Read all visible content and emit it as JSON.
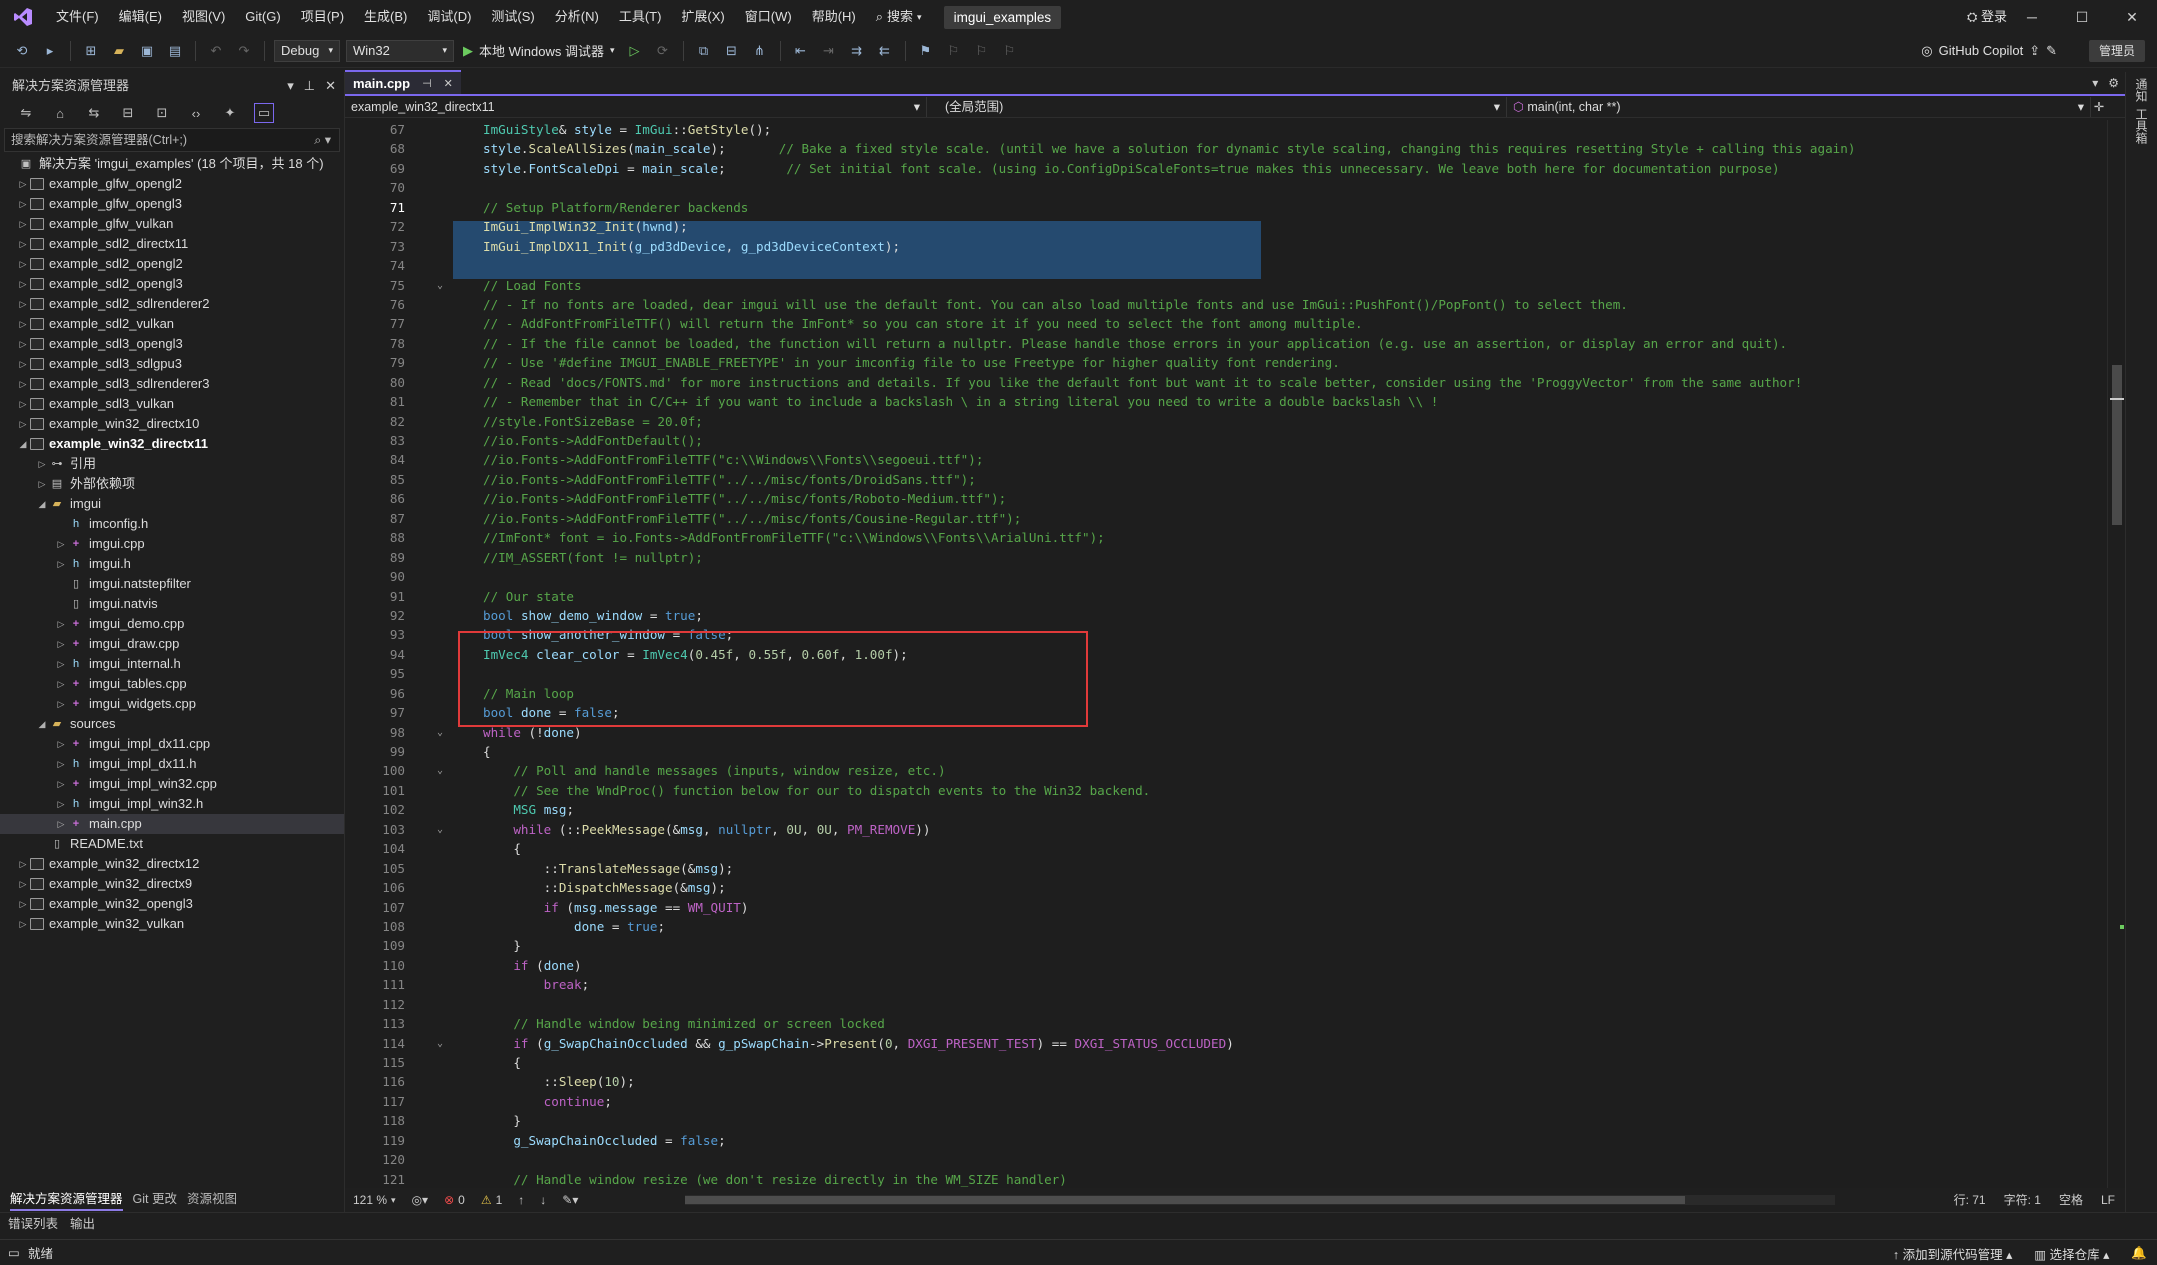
{
  "menubar": {
    "items": [
      "文件(F)",
      "编辑(E)",
      "视图(V)",
      "Git(G)",
      "项目(P)",
      "生成(B)",
      "调试(D)",
      "测试(S)",
      "分析(N)",
      "工具(T)",
      "扩展(X)",
      "窗口(W)",
      "帮助(H)"
    ],
    "search": "搜索",
    "solution_name": "imgui_examples",
    "login": "登录"
  },
  "toolbar": {
    "config": "Debug",
    "platform": "Win32",
    "run_label": "本地 Windows 调试器",
    "copilot": "GitHub Copilot",
    "admin": "管理员"
  },
  "solution_explorer": {
    "title": "解决方案资源管理器",
    "search_placeholder": "搜索解决方案资源管理器(Ctrl+;)",
    "items": [
      {
        "label": "解决方案 'imgui_examples' (18 个项目，共 18 个)",
        "indent": 0,
        "chev": "",
        "icon": "solution"
      },
      {
        "label": "example_glfw_opengl2",
        "indent": 1,
        "chev": "▷",
        "icon": "proj"
      },
      {
        "label": "example_glfw_opengl3",
        "indent": 1,
        "chev": "▷",
        "icon": "proj"
      },
      {
        "label": "example_glfw_vulkan",
        "indent": 1,
        "chev": "▷",
        "icon": "proj"
      },
      {
        "label": "example_sdl2_directx11",
        "indent": 1,
        "chev": "▷",
        "icon": "proj"
      },
      {
        "label": "example_sdl2_opengl2",
        "indent": 1,
        "chev": "▷",
        "icon": "proj"
      },
      {
        "label": "example_sdl2_opengl3",
        "indent": 1,
        "chev": "▷",
        "icon": "proj"
      },
      {
        "label": "example_sdl2_sdlrenderer2",
        "indent": 1,
        "chev": "▷",
        "icon": "proj"
      },
      {
        "label": "example_sdl2_vulkan",
        "indent": 1,
        "chev": "▷",
        "icon": "proj"
      },
      {
        "label": "example_sdl3_opengl3",
        "indent": 1,
        "chev": "▷",
        "icon": "proj"
      },
      {
        "label": "example_sdl3_sdlgpu3",
        "indent": 1,
        "chev": "▷",
        "icon": "proj"
      },
      {
        "label": "example_sdl3_sdlrenderer3",
        "indent": 1,
        "chev": "▷",
        "icon": "proj"
      },
      {
        "label": "example_sdl3_vulkan",
        "indent": 1,
        "chev": "▷",
        "icon": "proj"
      },
      {
        "label": "example_win32_directx10",
        "indent": 1,
        "chev": "▷",
        "icon": "proj"
      },
      {
        "label": "example_win32_directx11",
        "indent": 1,
        "chev": "◢",
        "icon": "proj",
        "bold": true
      },
      {
        "label": "引用",
        "indent": 2,
        "chev": "▷",
        "icon": "ref"
      },
      {
        "label": "外部依赖项",
        "indent": 2,
        "chev": "▷",
        "icon": "ext"
      },
      {
        "label": "imgui",
        "indent": 2,
        "chev": "◢",
        "icon": "folder"
      },
      {
        "label": "imconfig.h",
        "indent": 3,
        "chev": "",
        "icon": "h"
      },
      {
        "label": "imgui.cpp",
        "indent": 3,
        "chev": "▷",
        "icon": "cpp"
      },
      {
        "label": "imgui.h",
        "indent": 3,
        "chev": "▷",
        "icon": "h"
      },
      {
        "label": "imgui.natstepfilter",
        "indent": 3,
        "chev": "",
        "icon": "file"
      },
      {
        "label": "imgui.natvis",
        "indent": 3,
        "chev": "",
        "icon": "file"
      },
      {
        "label": "imgui_demo.cpp",
        "indent": 3,
        "chev": "▷",
        "icon": "cpp"
      },
      {
        "label": "imgui_draw.cpp",
        "indent": 3,
        "chev": "▷",
        "icon": "cpp"
      },
      {
        "label": "imgui_internal.h",
        "indent": 3,
        "chev": "▷",
        "icon": "h"
      },
      {
        "label": "imgui_tables.cpp",
        "indent": 3,
        "chev": "▷",
        "icon": "cpp"
      },
      {
        "label": "imgui_widgets.cpp",
        "indent": 3,
        "chev": "▷",
        "icon": "cpp"
      },
      {
        "label": "sources",
        "indent": 2,
        "chev": "◢",
        "icon": "folder"
      },
      {
        "label": "imgui_impl_dx11.cpp",
        "indent": 3,
        "chev": "▷",
        "icon": "cpp"
      },
      {
        "label": "imgui_impl_dx11.h",
        "indent": 3,
        "chev": "▷",
        "icon": "h"
      },
      {
        "label": "imgui_impl_win32.cpp",
        "indent": 3,
        "chev": "▷",
        "icon": "cpp"
      },
      {
        "label": "imgui_impl_win32.h",
        "indent": 3,
        "chev": "▷",
        "icon": "h"
      },
      {
        "label": "main.cpp",
        "indent": 3,
        "chev": "▷",
        "icon": "cpp",
        "selected": true
      },
      {
        "label": "README.txt",
        "indent": 2,
        "chev": "",
        "icon": "file"
      },
      {
        "label": "example_win32_directx12",
        "indent": 1,
        "chev": "▷",
        "icon": "proj"
      },
      {
        "label": "example_win32_directx9",
        "indent": 1,
        "chev": "▷",
        "icon": "proj"
      },
      {
        "label": "example_win32_opengl3",
        "indent": 1,
        "chev": "▷",
        "icon": "proj"
      },
      {
        "label": "example_win32_vulkan",
        "indent": 1,
        "chev": "▷",
        "icon": "proj"
      }
    ],
    "bottom_tabs": [
      "解决方案资源管理器",
      "Git 更改",
      "资源视图"
    ]
  },
  "editor": {
    "tab": "main.cpp",
    "nav_project": "example_win32_directx11",
    "nav_scope": "(全局范围)",
    "nav_function": "main(int, char **)",
    "current_line": 71,
    "lines": [
      {
        "n": 67,
        "indent": 1,
        "html": "<span class=\"t\">ImGuiStyle</span>&amp; <span class=\"v\">style</span> = <span class=\"t\">ImGui</span>::<span class=\"f\">GetStyle</span>();"
      },
      {
        "n": 68,
        "indent": 1,
        "html": "<span class=\"v\">style</span>.<span class=\"f\">ScaleAllSizes</span>(<span class=\"v\">main_scale</span>);       <span class=\"c\">// Bake a fixed style scale. (until we have a solution for dynamic style scaling, changing this requires resetting Style + calling this again)</span>"
      },
      {
        "n": 69,
        "indent": 1,
        "html": "<span class=\"v\">style</span>.<span class=\"v\">FontScaleDpi</span> = <span class=\"v\">main_scale</span>;        <span class=\"c\">// Set initial font scale. (using io.ConfigDpiScaleFonts=true makes this unnecessary. We leave both here for documentation purpose)</span>"
      },
      {
        "n": 70,
        "indent": 0,
        "html": ""
      },
      {
        "n": 71,
        "indent": 1,
        "sel": true,
        "html": "<span class=\"c\">// Setup Platform/Renderer backends</span>"
      },
      {
        "n": 72,
        "indent": 1,
        "sel": true,
        "html": "<span class=\"f\">ImGui_ImplWin32_Init</span>(<span class=\"v\">hwnd</span>);"
      },
      {
        "n": 73,
        "indent": 1,
        "sel": true,
        "html": "<span class=\"f\">ImGui_ImplDX11_Init</span>(<span class=\"v\">g_pd3dDevice</span>, <span class=\"v\">g_pd3dDeviceContext</span>);"
      },
      {
        "n": 74,
        "indent": 0,
        "html": ""
      },
      {
        "n": 75,
        "indent": 1,
        "fold": true,
        "html": "<span class=\"c\">// Load Fonts</span>"
      },
      {
        "n": 76,
        "indent": 1,
        "html": "<span class=\"c\">// - If no fonts are loaded, dear imgui will use the default font. You can also load multiple fonts and use ImGui::PushFont()/PopFont() to select them.</span>"
      },
      {
        "n": 77,
        "indent": 1,
        "html": "<span class=\"c\">// - AddFontFromFileTTF() will return the ImFont* so you can store it if you need to select the font among multiple.</span>"
      },
      {
        "n": 78,
        "indent": 1,
        "html": "<span class=\"c\">// - If the file cannot be loaded, the function will return a nullptr. Please handle those errors in your application (e.g. use an assertion, or display an error and quit).</span>"
      },
      {
        "n": 79,
        "indent": 1,
        "html": "<span class=\"c\">// - Use '#define IMGUI_ENABLE_FREETYPE' in your imconfig file to use Freetype for higher quality font rendering.</span>"
      },
      {
        "n": 80,
        "indent": 1,
        "html": "<span class=\"c\">// - Read 'docs/FONTS.md' for more instructions and details. If you like the default font but want it to scale better, consider using the 'ProggyVector' from the same author!</span>"
      },
      {
        "n": 81,
        "indent": 1,
        "html": "<span class=\"c\">// - Remember that in C/C++ if you want to include a backslash \\ in a string literal you need to write a double backslash \\\\ !</span>"
      },
      {
        "n": 82,
        "indent": 1,
        "html": "<span class=\"c\">//style.FontSizeBase = 20.0f;</span>"
      },
      {
        "n": 83,
        "indent": 1,
        "html": "<span class=\"c\">//io.Fonts-&gt;AddFontDefault();</span>"
      },
      {
        "n": 84,
        "indent": 1,
        "html": "<span class=\"c\">//io.Fonts-&gt;AddFontFromFileTTF(\"c:\\\\Windows\\\\Fonts\\\\segoeui.ttf\");</span>"
      },
      {
        "n": 85,
        "indent": 1,
        "html": "<span class=\"c\">//io.Fonts-&gt;AddFontFromFileTTF(\"../../misc/fonts/DroidSans.ttf\");</span>"
      },
      {
        "n": 86,
        "indent": 1,
        "html": "<span class=\"c\">//io.Fonts-&gt;AddFontFromFileTTF(\"../../misc/fonts/Roboto-Medium.ttf\");</span>"
      },
      {
        "n": 87,
        "indent": 1,
        "html": "<span class=\"c\">//io.Fonts-&gt;AddFontFromFileTTF(\"../../misc/fonts/Cousine-Regular.ttf\");</span>"
      },
      {
        "n": 88,
        "indent": 1,
        "html": "<span class=\"c\">//ImFont* font = io.Fonts-&gt;AddFontFromFileTTF(\"c:\\\\Windows\\\\Fonts\\\\ArialUni.ttf\");</span>"
      },
      {
        "n": 89,
        "indent": 1,
        "html": "<span class=\"c\">//IM_ASSERT(font != nullptr);</span>"
      },
      {
        "n": 90,
        "indent": 0,
        "html": ""
      },
      {
        "n": 91,
        "indent": 1,
        "html": "<span class=\"c\">// Our state</span>"
      },
      {
        "n": 92,
        "indent": 1,
        "html": "<span class=\"k\">bool</span> <span class=\"v\">show_demo_window</span> = <span class=\"k\">true</span>;"
      },
      {
        "n": 93,
        "indent": 1,
        "html": "<span class=\"k\">bool</span> <span class=\"v\">show_another_window</span> = <span class=\"k\">false</span>;"
      },
      {
        "n": 94,
        "indent": 1,
        "html": "<span class=\"t\">ImVec4</span> <span class=\"v\">clear_color</span> = <span class=\"t\">ImVec4</span>(<span class=\"n\">0.45f</span>, <span class=\"n\">0.55f</span>, <span class=\"n\">0.60f</span>, <span class=\"n\">1.00f</span>);"
      },
      {
        "n": 95,
        "indent": 0,
        "html": ""
      },
      {
        "n": 96,
        "indent": 1,
        "html": "<span class=\"c\">// Main loop</span>"
      },
      {
        "n": 97,
        "indent": 1,
        "html": "<span class=\"k\">bool</span> <span class=\"v\">done</span> = <span class=\"k\">false</span>;"
      },
      {
        "n": 98,
        "indent": 1,
        "fold": true,
        "html": "<span class=\"m\">while</span> (!<span class=\"v\">done</span>)"
      },
      {
        "n": 99,
        "indent": 1,
        "html": "{"
      },
      {
        "n": 100,
        "indent": 2,
        "fold": true,
        "html": "<span class=\"c\">// Poll and handle messages (inputs, window resize, etc.)</span>"
      },
      {
        "n": 101,
        "indent": 2,
        "html": "<span class=\"c\">// See the WndProc() function below for our to dispatch events to the Win32 backend.</span>"
      },
      {
        "n": 102,
        "indent": 2,
        "html": "<span class=\"t\">MSG</span> <span class=\"v\">msg</span>;"
      },
      {
        "n": 103,
        "indent": 2,
        "fold": true,
        "html": "<span class=\"m\">while</span> (::<span class=\"f\">PeekMessage</span>(&amp;<span class=\"v\">msg</span>, <span class=\"k\">nullptr</span>, <span class=\"n\">0U</span>, <span class=\"n\">0U</span>, <span class=\"m\">PM_REMOVE</span>))"
      },
      {
        "n": 104,
        "indent": 2,
        "html": "{"
      },
      {
        "n": 105,
        "indent": 3,
        "html": "::<span class=\"f\">TranslateMessage</span>(&amp;<span class=\"v\">msg</span>);"
      },
      {
        "n": 106,
        "indent": 3,
        "html": "::<span class=\"f\">DispatchMessage</span>(&amp;<span class=\"v\">msg</span>);"
      },
      {
        "n": 107,
        "indent": 3,
        "html": "<span class=\"m\">if</span> (<span class=\"v\">msg</span>.<span class=\"v\">message</span> == <span class=\"m\">WM_QUIT</span>)"
      },
      {
        "n": 108,
        "indent": 4,
        "html": "<span class=\"v\">done</span> = <span class=\"k\">true</span>;"
      },
      {
        "n": 109,
        "indent": 2,
        "html": "}"
      },
      {
        "n": 110,
        "indent": 2,
        "html": "<span class=\"m\">if</span> (<span class=\"v\">done</span>)"
      },
      {
        "n": 111,
        "indent": 3,
        "html": "<span class=\"m\">break</span>;"
      },
      {
        "n": 112,
        "indent": 0,
        "html": ""
      },
      {
        "n": 113,
        "indent": 2,
        "html": "<span class=\"c\">// Handle window being minimized or screen locked</span>"
      },
      {
        "n": 114,
        "indent": 2,
        "fold": true,
        "html": "<span class=\"m\">if</span> (<span class=\"v\">g_SwapChainOccluded</span> &amp;&amp; <span class=\"v\">g_pSwapChain</span>-&gt;<span class=\"f\">Present</span>(<span class=\"n\">0</span>, <span class=\"m\">DXGI_PRESENT_TEST</span>) == <span class=\"m\">DXGI_STATUS_OCCLUDED</span>)"
      },
      {
        "n": 115,
        "indent": 2,
        "html": "{"
      },
      {
        "n": 116,
        "indent": 3,
        "html": "::<span class=\"f\">Sleep</span>(<span class=\"n\">10</span>);"
      },
      {
        "n": 117,
        "indent": 3,
        "html": "<span class=\"m\">continue</span>;"
      },
      {
        "n": 118,
        "indent": 2,
        "html": "}"
      },
      {
        "n": 119,
        "indent": 2,
        "html": "<span class=\"v\">g_SwapChainOccluded</span> = <span class=\"k\">false</span>;"
      },
      {
        "n": 120,
        "indent": 0,
        "html": ""
      },
      {
        "n": 121,
        "indent": 2,
        "html": "<span class=\"c\">// Handle window resize (we don't resize directly in the WM_SIZE handler)</span>"
      }
    ]
  },
  "editor_status": {
    "zoom": "121 %",
    "errors": "0",
    "warnings": "1",
    "line": "行: 71",
    "char": "字符: 1",
    "whitespace": "空格",
    "eol": "LF"
  },
  "right_strip": [
    "通知",
    "工具箱"
  ],
  "bottom_tabs": [
    "错误列表",
    "输出"
  ],
  "statusbar": {
    "ready": "就绪",
    "source_control": "添加到源代码管理",
    "repo": "选择仓库"
  }
}
